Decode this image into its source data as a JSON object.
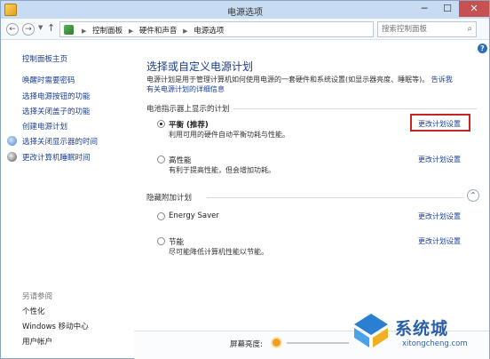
{
  "window": {
    "title": "电源选项",
    "min_glyph": "─",
    "max_glyph": "☐",
    "close_glyph": "✕"
  },
  "address": {
    "back_glyph": "←",
    "forward_glyph": "→",
    "up_glyph": "↑",
    "crumbs": [
      "控制面板",
      "硬件和声音",
      "电源选项"
    ],
    "refresh_glyph": "↻",
    "search_placeholder": "搜索控制面板",
    "search_glyph": "⌕"
  },
  "help_glyph": "?",
  "sidebar": {
    "home": "控制面板主页",
    "links": [
      "唤醒时需要密码",
      "选择电源按钮的功能",
      "选择关闭盖子的功能",
      "创建电源计划",
      "选择关闭显示器的时间",
      "更改计算机睡眠时间"
    ],
    "see_also": "另请参阅",
    "bottom_links": [
      "个性化",
      "Windows 移动中心",
      "用户帐户"
    ],
    "icons": [
      "monitor-icon",
      "moon-icon"
    ]
  },
  "main": {
    "title": "选择或自定义电源计划",
    "intro": "电源计划是用于管理计算机如何使用电源的一套硬件和系统设置(如显示器亮度、睡眠等)。",
    "intro_link_1": "告诉我",
    "intro_link_2": "有关电源计划的详细信息",
    "battery_section": "电池指示器上显示的计划",
    "hidden_section": "隐藏附加计划",
    "collapse_glyph": "⌃",
    "plans": [
      {
        "name": "平衡 (推荐)",
        "desc": "利用可用的硬件自动平衡功耗与性能。",
        "link": "更改计划设置",
        "checked": true
      },
      {
        "name": "高性能",
        "desc": "有利于提高性能，但会增加功耗。",
        "link": "更改计划设置",
        "checked": false
      },
      {
        "name": "Energy Saver",
        "desc": "",
        "link": "更改计划设置",
        "checked": false
      },
      {
        "name": "节能",
        "desc": "尽可能降低计算机性能以节能。",
        "link": "更改计划设置",
        "checked": false
      }
    ]
  },
  "bottom": {
    "brightness_label": "屏幕亮度:"
  },
  "watermark": {
    "text": "系统城",
    "url": "xitongcheng.com"
  },
  "colors": {
    "accent": "#1c3f94",
    "title_bar": "#c7dcf2",
    "highlight": "#c42626"
  }
}
